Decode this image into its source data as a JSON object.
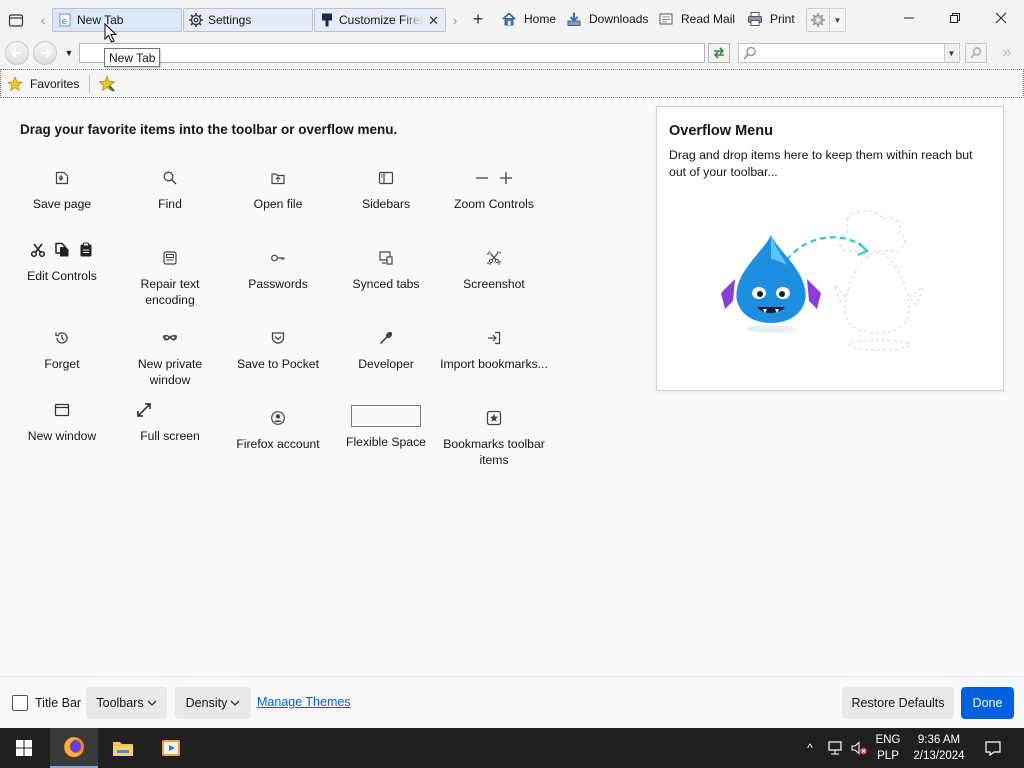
{
  "tabs": [
    {
      "label": "New Tab",
      "selected": true
    },
    {
      "label": "Settings",
      "selected": false
    },
    {
      "label": "Customize Firefox",
      "selected": false
    }
  ],
  "toolbar_buttons": {
    "home": "Home",
    "downloads": "Downloads",
    "read_mail": "Read Mail",
    "print": "Print"
  },
  "bookmarks": {
    "favorites": "Favorites"
  },
  "tooltip": "New Tab",
  "palette": {
    "title": "Drag your favorite items into the toolbar or overflow menu.",
    "items": [
      {
        "label": "Save page",
        "icon": "save-page-icon"
      },
      {
        "label": "Find",
        "icon": "find-icon"
      },
      {
        "label": "Open file",
        "icon": "open-file-icon"
      },
      {
        "label": "Sidebars",
        "icon": "sidebars-icon"
      },
      {
        "label": "Zoom Controls",
        "icon": "zoom-icon"
      },
      {
        "label": "Edit Controls",
        "icon": "edit-controls-icon"
      },
      {
        "label": "Repair text encoding",
        "icon": "text-encoding-icon"
      },
      {
        "label": "Passwords",
        "icon": "key-icon"
      },
      {
        "label": "Synced tabs",
        "icon": "synced-tabs-icon"
      },
      {
        "label": "Screenshot",
        "icon": "screenshot-icon"
      },
      {
        "label": "Forget",
        "icon": "forget-icon"
      },
      {
        "label": "New private window",
        "icon": "private-mask-icon"
      },
      {
        "label": "Save to Pocket",
        "icon": "pocket-icon"
      },
      {
        "label": "Developer",
        "icon": "wrench-icon"
      },
      {
        "label": "Import bookmarks...",
        "icon": "import-icon"
      },
      {
        "label": "New window",
        "icon": "new-window-icon"
      },
      {
        "label": "Full screen",
        "icon": "fullscreen-icon"
      },
      {
        "label": "Firefox account",
        "icon": "account-icon"
      },
      {
        "label": "Flexible Space",
        "icon": "flexible-space"
      },
      {
        "label": "Bookmarks toolbar items",
        "icon": "bookmark-star-icon"
      }
    ]
  },
  "overflow": {
    "title": "Overflow Menu",
    "description": "Drag and drop items here to keep them within reach but out of your toolbar..."
  },
  "footer": {
    "title_bar": "Title Bar",
    "toolbars": "Toolbars",
    "density": "Density",
    "manage_themes": "Manage Themes",
    "restore_defaults": "Restore Defaults",
    "done": "Done"
  },
  "taskbar": {
    "lang1": "ENG",
    "lang2": "PLP",
    "time": "9:36 AM",
    "date": "2/13/2024"
  },
  "colors": {
    "accent": "#0061e0",
    "link": "#0061e0",
    "taskbar": "#202020"
  }
}
